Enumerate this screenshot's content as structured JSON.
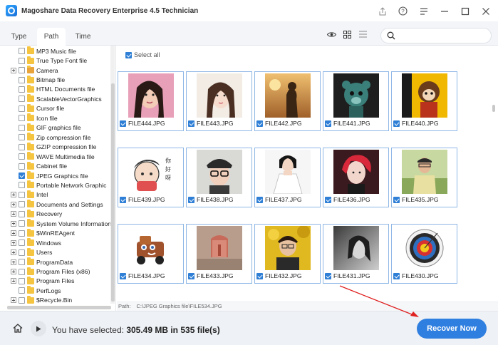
{
  "window": {
    "title": "Magoshare Data Recovery Enterprise 4.5 Technician",
    "controls": [
      "share-icon",
      "help-icon",
      "menu-icon",
      "minimize-icon",
      "maximize-icon",
      "close-icon"
    ]
  },
  "tabs": [
    {
      "label": "Type",
      "active": false
    },
    {
      "label": "Path",
      "active": true
    },
    {
      "label": "Time",
      "active": false
    }
  ],
  "view_icons": [
    "eye-icon",
    "grid-view-icon",
    "list-view-icon"
  ],
  "search": {
    "placeholder": "",
    "value": ""
  },
  "tree": {
    "items": [
      {
        "label": "MP3 Music file",
        "expandable": false,
        "checked": false,
        "camera": false
      },
      {
        "label": "True Type Font file",
        "expandable": false,
        "checked": false,
        "camera": false
      },
      {
        "label": "Camera",
        "expandable": true,
        "checked": false,
        "camera": true
      },
      {
        "label": "Bitmap file",
        "expandable": false,
        "checked": false,
        "camera": false
      },
      {
        "label": "HTML Documents file",
        "expandable": false,
        "checked": false,
        "camera": false
      },
      {
        "label": "ScalableVectorGraphics",
        "expandable": false,
        "checked": false,
        "camera": false
      },
      {
        "label": "Cursor file",
        "expandable": false,
        "checked": false,
        "camera": false
      },
      {
        "label": "Icon file",
        "expandable": false,
        "checked": false,
        "camera": false
      },
      {
        "label": "GIF graphics file",
        "expandable": false,
        "checked": false,
        "camera": false
      },
      {
        "label": "Zip compression file",
        "expandable": false,
        "checked": false,
        "camera": false
      },
      {
        "label": "GZIP compression file",
        "expandable": false,
        "checked": false,
        "camera": false
      },
      {
        "label": "WAVE Multimedia file",
        "expandable": false,
        "checked": false,
        "camera": false
      },
      {
        "label": "Cabinet file",
        "expandable": false,
        "checked": false,
        "camera": false
      },
      {
        "label": "JPEG Graphics file",
        "expandable": false,
        "checked": true,
        "camera": false,
        "selected": true
      },
      {
        "label": "Portable Network Graphic",
        "expandable": false,
        "checked": false,
        "camera": false
      },
      {
        "label": "Intel",
        "expandable": true,
        "checked": false,
        "camera": false
      },
      {
        "label": "Documents and Settings",
        "expandable": true,
        "checked": false,
        "camera": false
      },
      {
        "label": "Recovery",
        "expandable": true,
        "checked": false,
        "camera": false
      },
      {
        "label": "System Volume Information",
        "expandable": true,
        "checked": false,
        "camera": false
      },
      {
        "label": "$WinREAgent",
        "expandable": true,
        "checked": false,
        "camera": false
      },
      {
        "label": "Windows",
        "expandable": true,
        "checked": false,
        "camera": false
      },
      {
        "label": "Users",
        "expandable": true,
        "checked": false,
        "camera": false
      },
      {
        "label": "ProgramData",
        "expandable": true,
        "checked": false,
        "camera": false
      },
      {
        "label": "Program Files (x86)",
        "expandable": true,
        "checked": false,
        "camera": false
      },
      {
        "label": "Program Files",
        "expandable": true,
        "checked": false,
        "camera": false
      },
      {
        "label": "PerfLogs",
        "expandable": false,
        "checked": false,
        "camera": false
      },
      {
        "label": "$Recycle.Bin",
        "expandable": true,
        "checked": false,
        "camera": false
      }
    ]
  },
  "main": {
    "select_all_label": "Select all",
    "files": [
      {
        "name": "FILE444.JPG",
        "checked": true,
        "thumb": "woman-face-pink"
      },
      {
        "name": "FILE443.JPG",
        "checked": true,
        "thumb": "woman-face-light"
      },
      {
        "name": "FILE442.JPG",
        "checked": true,
        "thumb": "silhouette-sunset"
      },
      {
        "name": "FILE441.JPG",
        "checked": true,
        "thumb": "teddy-bear-mask"
      },
      {
        "name": "FILE440.JPG",
        "checked": true,
        "thumb": "monkey-doll"
      },
      {
        "name": "FILE439.JPG",
        "checked": true,
        "thumb": "cartoon-sticker"
      },
      {
        "name": "FILE438.JPG",
        "checked": true,
        "thumb": "man-glasses-hat"
      },
      {
        "name": "FILE437.JPG",
        "checked": true,
        "thumb": "woman-white-dress"
      },
      {
        "name": "FILE436.JPG",
        "checked": true,
        "thumb": "red-hair-boy"
      },
      {
        "name": "FILE435.JPG",
        "checked": true,
        "thumb": "man-outdoor"
      },
      {
        "name": "FILE434.JPG",
        "checked": true,
        "thumb": "cartoon-truck"
      },
      {
        "name": "FILE433.JPG",
        "checked": true,
        "thumb": "door-wall"
      },
      {
        "name": "FILE432.JPG",
        "checked": true,
        "thumb": "man-yellow-leaves"
      },
      {
        "name": "FILE431.JPG",
        "checked": true,
        "thumb": "mono-woman"
      },
      {
        "name": "FILE430.JPG",
        "checked": true,
        "thumb": "archery-target"
      }
    ]
  },
  "path_bar": {
    "label": "Path:",
    "value": "C:\\JPEG Graphics file\\FILE534.JPG"
  },
  "bottom": {
    "status_prefix": "You have selected: ",
    "status_value": "305.49 MB in 535 file(s)",
    "recover_label": "Recover Now"
  },
  "colors": {
    "accent": "#2f7fe0",
    "checkbox": "#2f7fd6",
    "folder": "#f5c542",
    "annotation_arrow": "#e02020"
  }
}
